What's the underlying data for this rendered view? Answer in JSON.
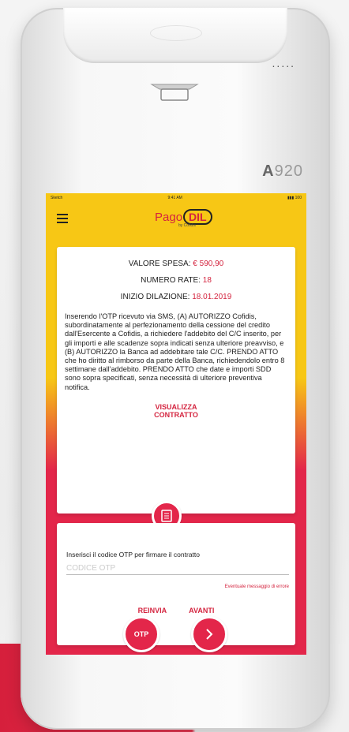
{
  "device": {
    "model_a": "A",
    "model_num": "920",
    "dots": "....."
  },
  "status_bar": {
    "carrier": "Sketch",
    "time": "9:41 AM",
    "battery": "100"
  },
  "app": {
    "logo_main": "Pago",
    "logo_pill": "DIL",
    "logo_sub": "by Cofidis"
  },
  "summary": {
    "spesa_label": "VALORE SPESA:",
    "spesa_value": "€ 590,90",
    "rate_label": "NUMERO RATE:",
    "rate_value": "18",
    "inizio_label": "INIZIO DILAZIONE:",
    "inizio_value": "18.01.2019"
  },
  "legal_text": "Inserendo l'OTP ricevuto via SMS, (A) AUTORIZZO Cofidis, subordinatamente al perfezionamento della cessione del credito dall'Esercente a Cofidis, a richiedere l'addebito del C/C inserito, per gli importi e alle scadenze sopra indicati senza ulteriore preavviso, e (B) AUTORIZZO la Banca ad addebitare tale C/C. PRENDO ATTO che ho diritto al rimborso da parte della Banca, richiedendolo entro 8 settimane dall'addebito. PRENDO ATTO che date e importi SDD sono sopra specificati, senza necessità di ulteriore preventiva notifica.",
  "contract_link": {
    "line1": "VISUALIZZA",
    "line2": "CONTRATTO"
  },
  "otp": {
    "label": "Inserisci il codice OTP per firmare il contratto",
    "placeholder": "CODICE OTP",
    "value": "",
    "error": "Eventuale messaggio di errore"
  },
  "actions": {
    "resend": "REINVIA",
    "next": "AVANTI",
    "otp_button": "OTP"
  },
  "colors": {
    "brand_red": "#e3264a",
    "brand_yellow": "#f7c715"
  }
}
